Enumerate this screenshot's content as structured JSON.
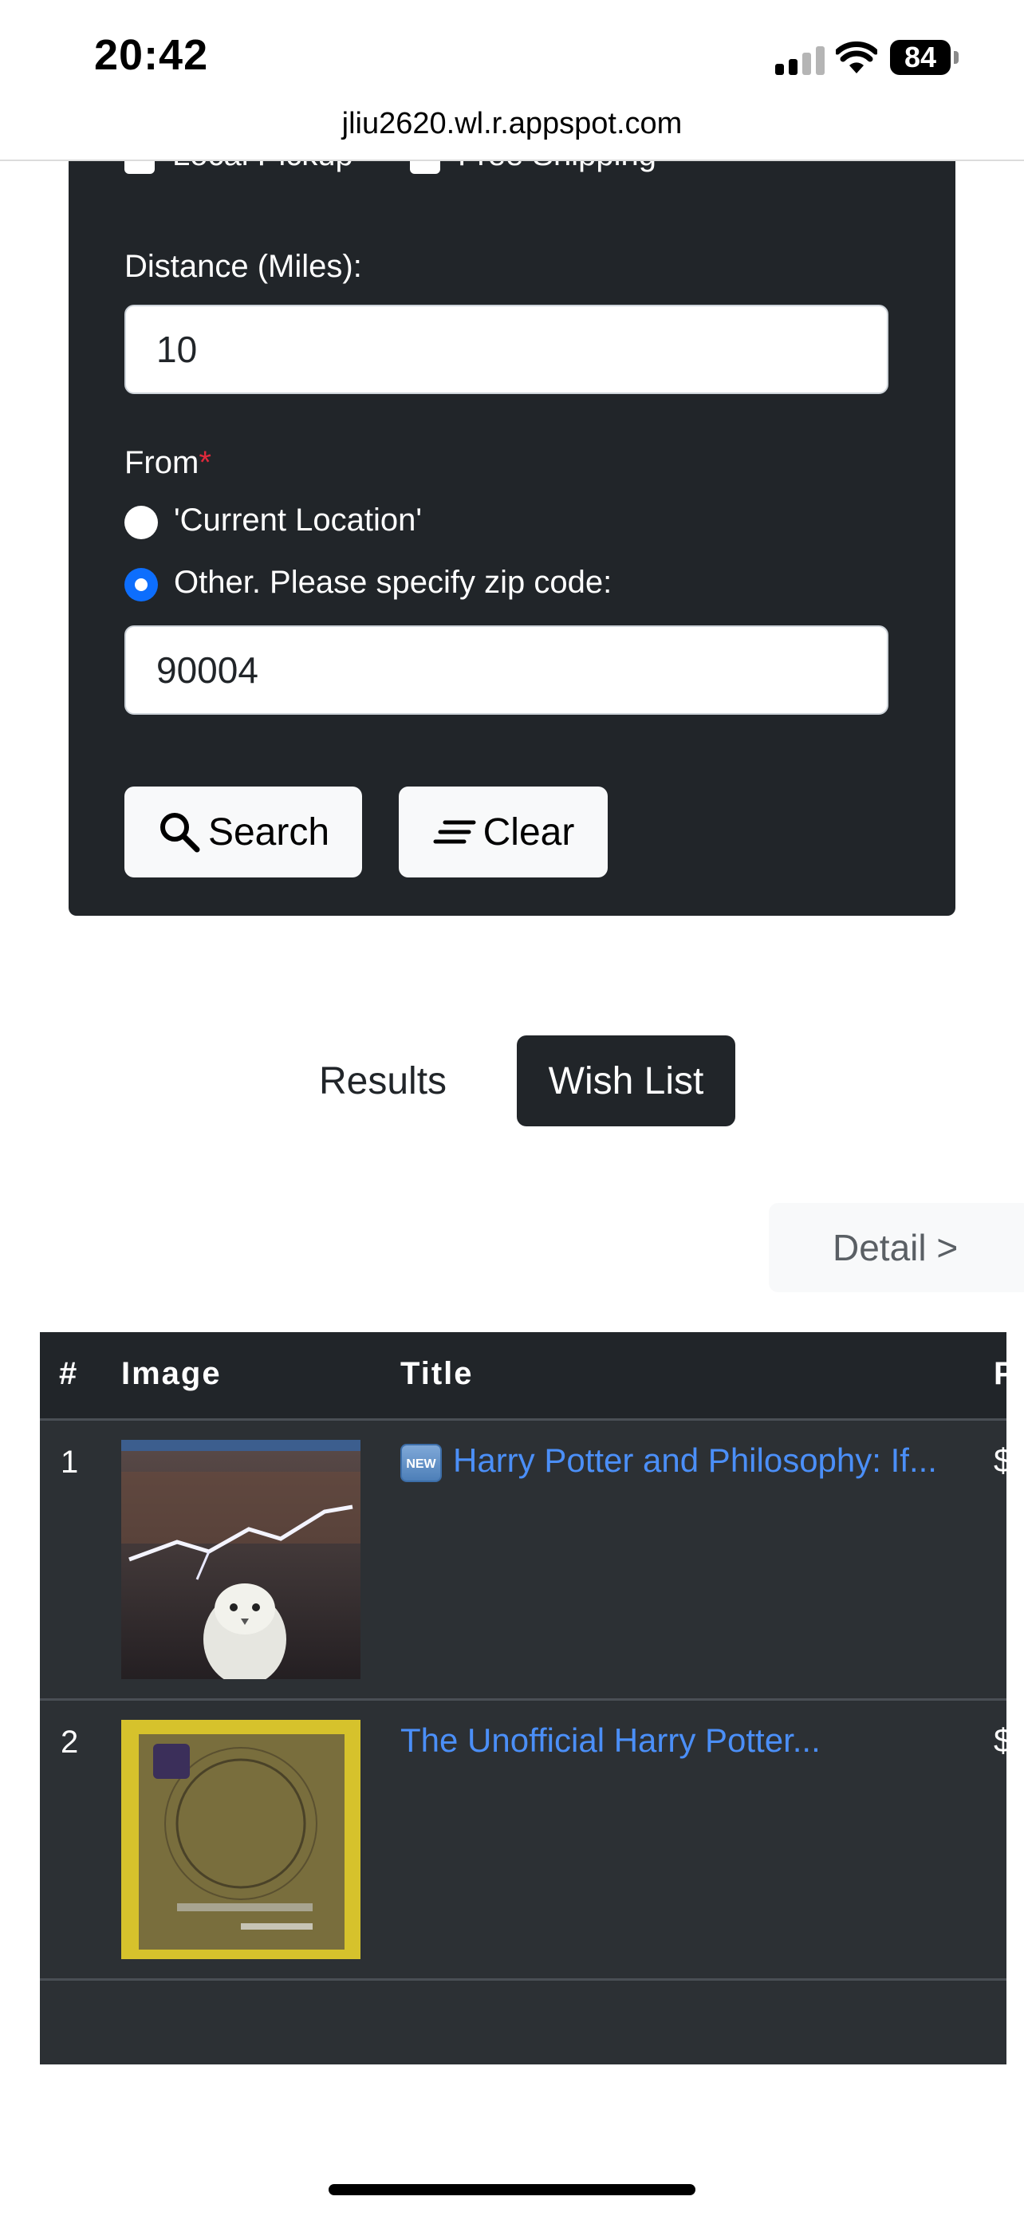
{
  "status_bar": {
    "time": "20:42",
    "battery": "84"
  },
  "browser": {
    "url": "jliu2620.wl.r.appspot.com"
  },
  "form": {
    "checkbox_local_pickup": "Local Pickup",
    "checkbox_free_shipping": "Free Shipping",
    "distance_label": "Distance (Miles):",
    "distance_value": "10",
    "from_label": "From",
    "required_mark": "*",
    "radio_current": "'Current Location'",
    "radio_other": "Other. Please specify zip code:",
    "zip_value": "90004",
    "search_label": "Search",
    "clear_label": "Clear"
  },
  "tabs": {
    "results": "Results",
    "wish_list": "Wish List"
  },
  "detail_button": "Detail >",
  "table": {
    "headers": {
      "num": "#",
      "image": "Image",
      "title": "Title",
      "price_partial": "P"
    },
    "rows": [
      {
        "num": "1",
        "badge": "NEW",
        "title": "Harry Potter and Philosophy: If...",
        "price_partial": "$"
      },
      {
        "num": "2",
        "title": "The Unofficial Harry Potter...",
        "price_partial": "$"
      }
    ]
  },
  "colors": {
    "panel": "#212529",
    "accent_blue": "#0d6efd",
    "link": "#4b8ff8",
    "required": "#e0293b"
  }
}
